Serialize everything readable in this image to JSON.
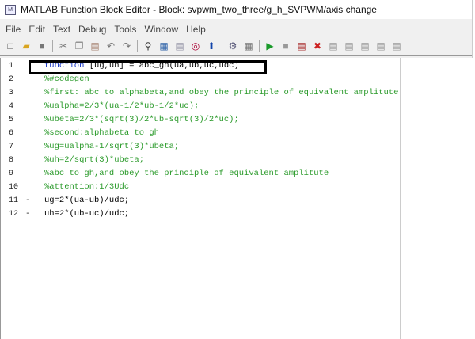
{
  "window": {
    "title": "MATLAB Function Block Editor - Block: svpwm_two_three/g_h_SVPWM/axis change",
    "app_icon": "M"
  },
  "menu": [
    "File",
    "Edit",
    "Text",
    "Debug",
    "Tools",
    "Window",
    "Help"
  ],
  "toolbar": [
    "new-icon",
    "open-icon",
    "save-icon",
    "cut-icon",
    "copy-icon",
    "paste-icon",
    "undo-icon",
    "redo-icon",
    "find-icon",
    "goto-icon",
    "doc-icon",
    "target-icon",
    "up-arrow-icon",
    "build-icon",
    "calendar-icon",
    "run-icon",
    "stop-icon",
    "step-icon",
    "clear-breakpoint-icon",
    "step-in-icon",
    "step-out-icon",
    "continue-icon",
    "stack-icon",
    "explore-icon"
  ],
  "code": [
    {
      "n": "1",
      "dash": "",
      "kw": "function",
      "rest": " [ug,uh] = abc_gh(ua,ub,uc,udc)",
      "comment": false
    },
    {
      "n": "2",
      "dash": "",
      "text": "%#codegen",
      "comment": true
    },
    {
      "n": "3",
      "dash": "",
      "text": "%first: abc to alphabeta,and obey the principle of equivalent amplitute",
      "comment": true
    },
    {
      "n": "4",
      "dash": "",
      "text": "%ualpha=2/3*(ua-1/2*ub-1/2*uc);",
      "comment": true
    },
    {
      "n": "5",
      "dash": "",
      "text": "%ubeta=2/3*(sqrt(3)/2*ub-sqrt(3)/2*uc);",
      "comment": true
    },
    {
      "n": "6",
      "dash": "",
      "text": "%second:alphabeta to gh",
      "comment": true
    },
    {
      "n": "7",
      "dash": "",
      "text": "%ug=ualpha-1/sqrt(3)*ubeta;",
      "comment": true
    },
    {
      "n": "8",
      "dash": "",
      "text": "%uh=2/sqrt(3)*ubeta;",
      "comment": true
    },
    {
      "n": "9",
      "dash": "",
      "text": "%abc to gh,and obey the principle of equivalent amplitute",
      "comment": true
    },
    {
      "n": "10",
      "dash": "",
      "text": "%attention:1/3Udc",
      "comment": true
    },
    {
      "n": "11",
      "dash": "-",
      "text": "ug=2*(ua-ub)/udc;",
      "comment": false
    },
    {
      "n": "12",
      "dash": "-",
      "text": "uh=2*(ub-uc)/udc;",
      "comment": false
    }
  ],
  "colors": {
    "comment": "#2a9a2a",
    "keyword": "#1030c0"
  }
}
